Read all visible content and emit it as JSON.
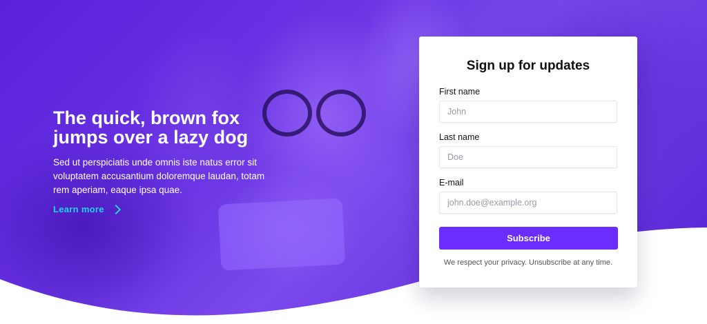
{
  "hero": {
    "headline_line1": "The quick, brown fox",
    "headline_line2": "jumps over a lazy dog",
    "description_line1": "Sed ut perspiciatis unde omnis iste natus error sit",
    "description_line2": "voluptatem accusantium doloremque laudan, totam",
    "description_line3": "rem aperiam, eaque ipsa quae.",
    "link_label": "Learn more",
    "link_icon": "chevron-right-icon"
  },
  "form": {
    "title": "Sign up for updates",
    "first_name": {
      "label": "First name",
      "placeholder": "John",
      "value": ""
    },
    "last_name": {
      "label": "Last name",
      "placeholder": "Doe",
      "value": ""
    },
    "email": {
      "label": "E-mail",
      "placeholder": "john.doe@example.org",
      "value": ""
    },
    "submit_label": "Subscribe",
    "privacy_text": "We respect your privacy. Unsubscribe at any time."
  },
  "colors": {
    "hero_purple": "#5a20db",
    "accent_link": "#22d3ee",
    "button": "#6a2cff"
  }
}
